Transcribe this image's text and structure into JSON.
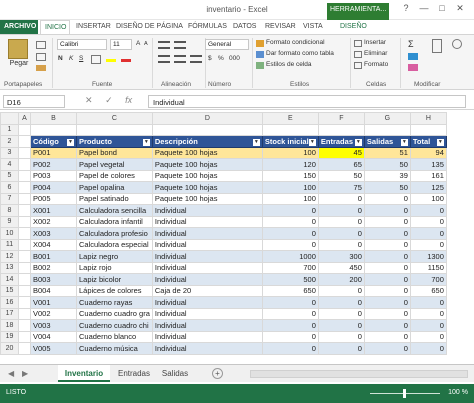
{
  "window": {
    "title": "inventario - Excel",
    "contextual_tab_head": "HERRAMIENTA...",
    "help": "?",
    "minimize": "—",
    "maximize": "□",
    "close": "✕"
  },
  "tabs": [
    "ARCHIVO",
    "INICIO",
    "INSERTAR",
    "DISEÑO DE PÁGINA",
    "FÓRMULAS",
    "DATOS",
    "REVISAR",
    "VISTA",
    "DISEÑO"
  ],
  "ribbon": {
    "paste": "Pegar",
    "font_name": "Calibri",
    "font_size": "11",
    "bold": "N",
    "italic": "K",
    "underline": "S",
    "grow": "A",
    "shrink": "A",
    "number_format": "General",
    "currency": "$",
    "percent": "%",
    "thousands": "000",
    "conditional_format": "Formato condicional",
    "format_as_table": "Dar formato como tabla",
    "cell_styles": "Estilos de celda",
    "insert": "Insertar",
    "delete": "Eliminar",
    "format": "Formato",
    "groups": {
      "clipboard": "Portapapeles",
      "font": "Fuente",
      "alignment": "Alineación",
      "number": "Número",
      "styles": "Estilos",
      "cells": "Celdas",
      "modify": "Modificar"
    }
  },
  "formula_bar": {
    "name_box": "D16",
    "cancel": "✕",
    "enter": "✓",
    "fx": "fx",
    "value": "Individual"
  },
  "sheet": {
    "columns": [
      "A",
      "B",
      "C",
      "D",
      "E",
      "F",
      "G",
      "H"
    ],
    "header_row": [
      "Código",
      "Producto",
      "Descripción",
      "Stock inicial",
      "Entradas",
      "Salidas",
      "Total"
    ],
    "rows": [
      [
        "P001",
        "Papel bond",
        "Paquete 100 hojas",
        "100",
        "45",
        "51",
        "94"
      ],
      [
        "P002",
        "Papel vegetal",
        "Paquete 100 hojas",
        "120",
        "65",
        "50",
        "135"
      ],
      [
        "P003",
        "Papel de colores",
        "Paquete 100 hojas",
        "150",
        "50",
        "39",
        "161"
      ],
      [
        "P004",
        "Papel opalina",
        "Paquete 100 hojas",
        "100",
        "75",
        "50",
        "125"
      ],
      [
        "P005",
        "Papel satinado",
        "Paquete 100 hojas",
        "100",
        "0",
        "0",
        "100"
      ],
      [
        "X001",
        "Calculadora sencilla",
        "Individual",
        "0",
        "0",
        "0",
        "0"
      ],
      [
        "X002",
        "Calculadora infantil",
        "Individual",
        "0",
        "0",
        "0",
        "0"
      ],
      [
        "X003",
        "Calculadora profesio",
        "Individual",
        "0",
        "0",
        "0",
        "0"
      ],
      [
        "X004",
        "Calculadora especial",
        "Individual",
        "0",
        "0",
        "0",
        "0"
      ],
      [
        "B001",
        "Lapiz negro",
        "Individual",
        "1000",
        "300",
        "0",
        "1300"
      ],
      [
        "B002",
        "Lapiz rojo",
        "Individual",
        "700",
        "450",
        "0",
        "1150"
      ],
      [
        "B003",
        "Lapiz bicolor",
        "Individual",
        "500",
        "200",
        "0",
        "700"
      ],
      [
        "B004",
        "Lápices de colores",
        "Caja de 20",
        "650",
        "0",
        "0",
        "650"
      ],
      [
        "V001",
        "Cuaderno rayas",
        "Individual",
        "0",
        "0",
        "0",
        "0"
      ],
      [
        "V002",
        "Cuaderno cuadro gra",
        "Individual",
        "0",
        "0",
        "0",
        "0"
      ],
      [
        "V003",
        "Cuaderno cuadro chi",
        "Individual",
        "0",
        "0",
        "0",
        "0"
      ],
      [
        "V004",
        "Cuaderno blanco",
        "Individual",
        "0",
        "0",
        "0",
        "0"
      ],
      [
        "V005",
        "Cuaderno música",
        "Individual",
        "0",
        "0",
        "0",
        "0"
      ]
    ]
  },
  "sheet_tabs": [
    "Inventario",
    "Entradas",
    "Salidas"
  ],
  "add_sheet": "+",
  "status": {
    "text": "LISTO",
    "zoom": "100 %"
  },
  "colors": {
    "excel_green": "#217346",
    "table_header": "#2f5597",
    "band": "#dce6f1",
    "highlight": "#ffff00",
    "selected_row": "#ffe699"
  }
}
